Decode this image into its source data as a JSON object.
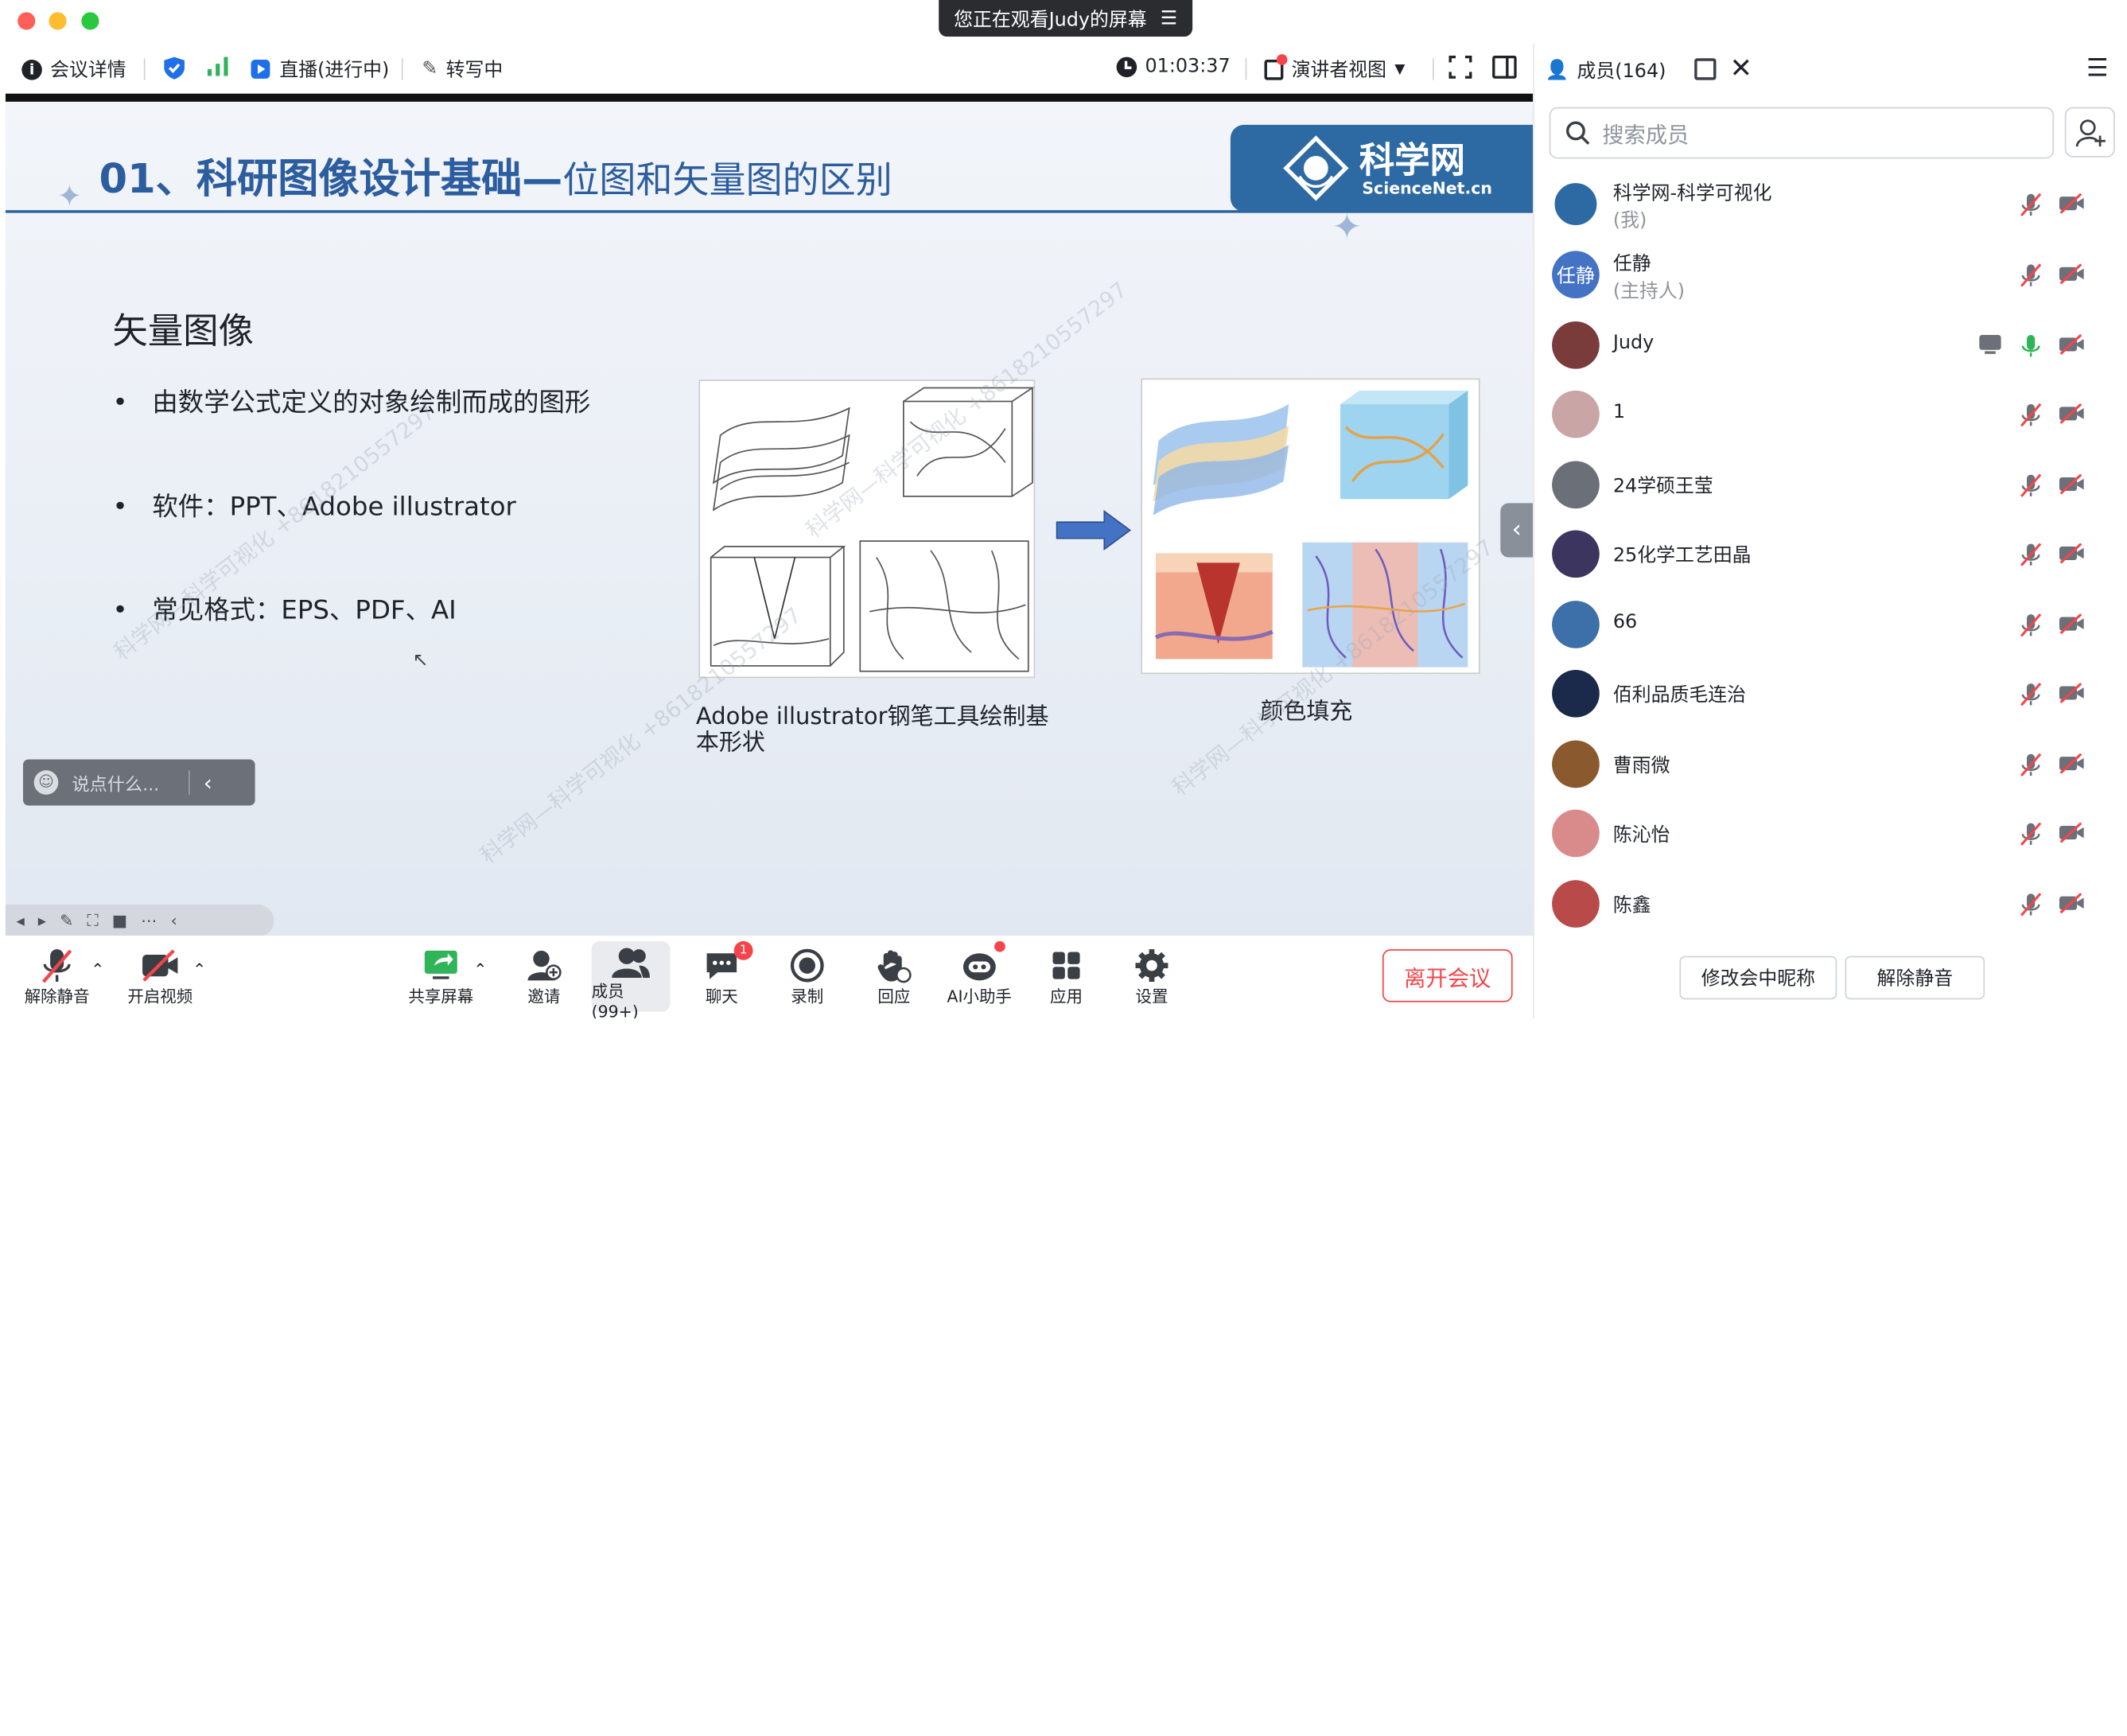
{
  "banner": {
    "text": "您正在观看Judy的屏幕"
  },
  "toolbar": {
    "meeting_info": "会议详情",
    "live": "直播(进行中)",
    "transcribe": "转写中",
    "timer": "01:03:37",
    "view": "演讲者视图"
  },
  "slide": {
    "title_bold": "01、科研图像设计基础—",
    "title_rest": "位图和矢量图的区别",
    "logo_cn": "科学网",
    "logo_en": "ScienceNet.cn",
    "heading": "矢量图像",
    "bullets": [
      "由数学公式定义的对象绘制而成的图形",
      "软件：PPT、Adobe illustrator",
      "常见格式：EPS、PDF、AI"
    ],
    "caption1": "Adobe illustrator钢笔工具绘制基本形状",
    "caption2": "颜色填充",
    "watermark": "科学网—科学可视化 +8618210557297"
  },
  "chat_input": {
    "placeholder": "说点什么..."
  },
  "bottombar": {
    "unmute": "解除静音",
    "video": "开启视频",
    "share": "共享屏幕",
    "invite": "邀请",
    "members": "成员(99+)",
    "chat": "聊天",
    "chat_badge": "1",
    "record": "录制",
    "reply": "回应",
    "ai": "AI小助手",
    "apps": "应用",
    "settings": "设置",
    "leave": "离开会议"
  },
  "panel": {
    "title": "成员(164)",
    "search_placeholder": "搜索成员",
    "members": [
      {
        "name": "科学网-科学可视化",
        "role": "(我)",
        "avatar": "logo"
      },
      {
        "name": "任静",
        "role": "(主持人)",
        "avatar": "任静"
      },
      {
        "name": "Judy",
        "role": "",
        "avatar": "photo"
      },
      {
        "name": "1",
        "role": "",
        "avatar": "photo"
      },
      {
        "name": "24学硕王莹",
        "role": "",
        "avatar": "photo"
      },
      {
        "name": "25化学工艺田晶",
        "role": "",
        "avatar": "photo"
      },
      {
        "name": "66",
        "role": "",
        "avatar": "photo"
      },
      {
        "name": "佰利品质毛连治",
        "role": "",
        "avatar": "photo"
      },
      {
        "name": "曹雨微",
        "role": "",
        "avatar": "photo"
      },
      {
        "name": "陈沁怡",
        "role": "",
        "avatar": "photo"
      },
      {
        "name": "陈鑫",
        "role": "",
        "avatar": "photo"
      }
    ],
    "rename_button": "修改会中昵称",
    "unmute_button": "解除静音"
  },
  "colors": {
    "accent": "#1f6fe8",
    "red": "#f5454a",
    "slide_title": "#2c5d9e",
    "logo_bg": "#2d6aa3"
  }
}
